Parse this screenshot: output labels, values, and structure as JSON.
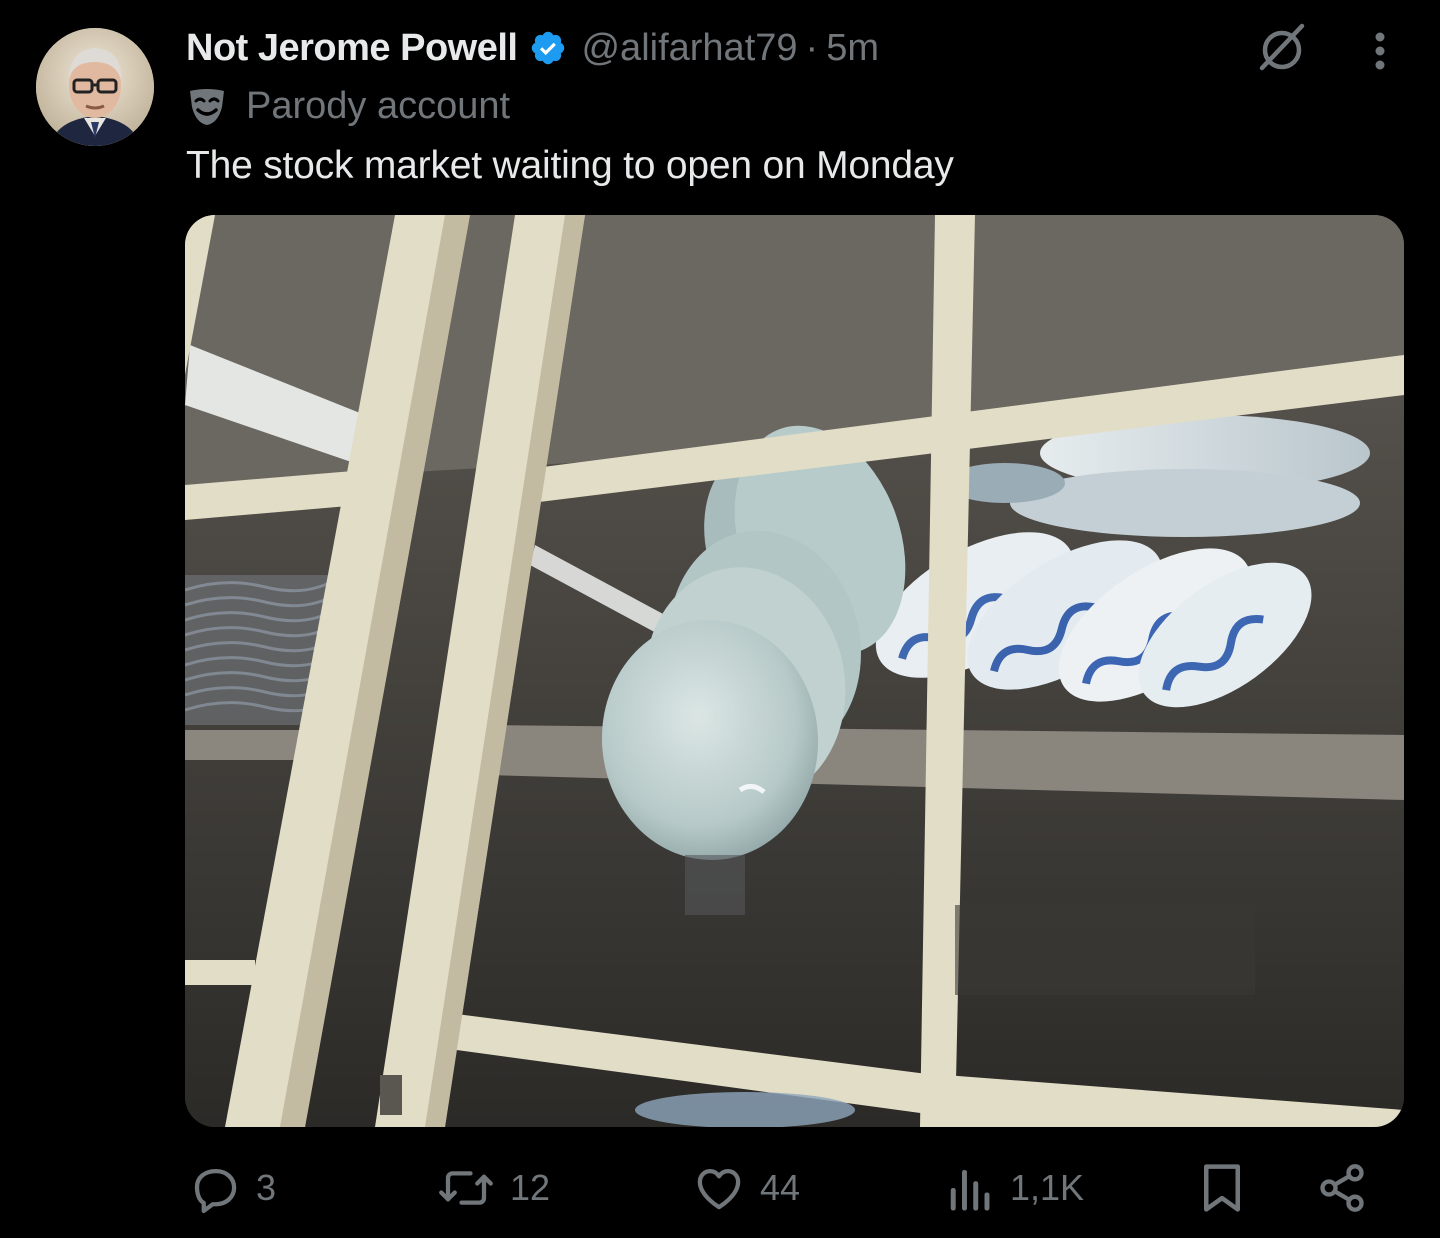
{
  "author": {
    "display_name": "Not Jerome Powell",
    "handle": "@alifarhat79",
    "separator": "·",
    "time": "5m",
    "verified": true,
    "account_label": "Parody account",
    "avatar_icon": "profile-photo"
  },
  "tweet": {
    "text": "The stock market waiting to open on Monday",
    "media_icon": "photo-dish-cabinet"
  },
  "header_icons": [
    "grok-icon",
    "more-icon"
  ],
  "actions": {
    "reply_count": "3",
    "retweet_count": "12",
    "like_count": "44",
    "views_count": "1,1K",
    "bookmark_icon": "bookmark-icon",
    "share_icon": "share-icon"
  },
  "colors": {
    "background": "#000000",
    "text_primary": "#e7e9ea",
    "text_secondary": "#71767b",
    "verified_blue": "#1d9bf0"
  }
}
